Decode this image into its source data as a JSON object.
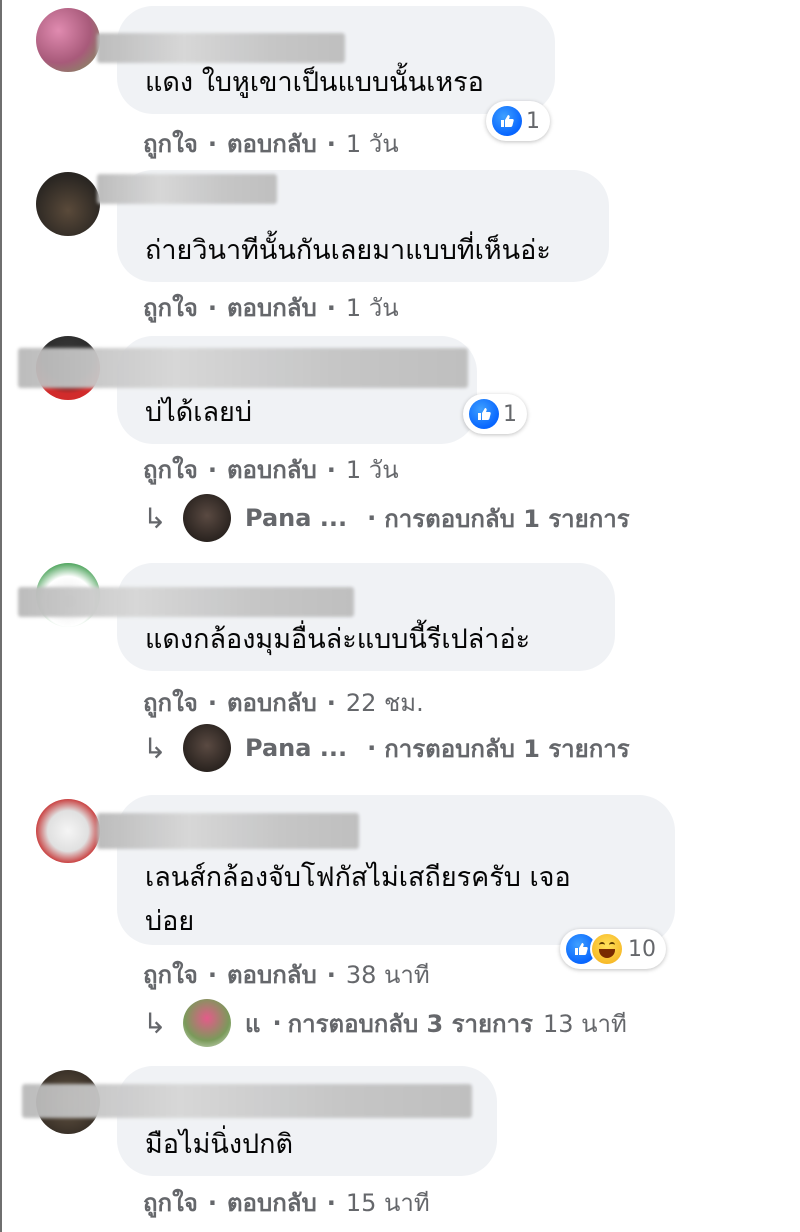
{
  "actions": {
    "like_label": "ถูกใจ",
    "reply_label": "ตอบกลับ",
    "separator": "·"
  },
  "icons": {
    "reply_arrow": "reply-arrow-icon",
    "like": "like-icon",
    "haha": "haha-icon"
  },
  "colors": {
    "bubble": "#f0f2f5",
    "meta_text": "#65676b",
    "like_blue": "#0866ff",
    "haha_yellow": "#f7b928"
  },
  "comments": [
    {
      "text": "แดง ใบหูเขาเป็นแบบนั้นเหรอ",
      "time": "1 วัน",
      "reaction_count": "1"
    },
    {
      "text": "ถ่ายวินาทีนั้นกันเลยมาแบบที่เห็นอ่ะ",
      "time": "1 วัน"
    },
    {
      "text": "บ่ได้เลยบ่",
      "time": "1 วัน",
      "reaction_count": "1",
      "reply": {
        "name": "Pana ...",
        "label": "การตอบกลับ 1 รายการ"
      }
    },
    {
      "text": "แดงกล้องมุมอื่นล่ะแบบนี้รีเปล่าอ่ะ",
      "time": "22 ชม.",
      "reply": {
        "name": "Pana ...",
        "label": "การตอบกลับ 1 รายการ"
      }
    },
    {
      "text_line1": "เลนส์กล้องจับโฟกัสไม่เสถียรครับ เจอ",
      "text_line2": "บ่อย",
      "time": "38 นาที",
      "reaction_count": "10",
      "reply": {
        "name": "แ",
        "label": "การตอบกลับ 3 รายการ",
        "time": "13 นาที"
      }
    },
    {
      "text": "มือไม่นิ่งปกติ",
      "time": "15 นาที"
    }
  ]
}
